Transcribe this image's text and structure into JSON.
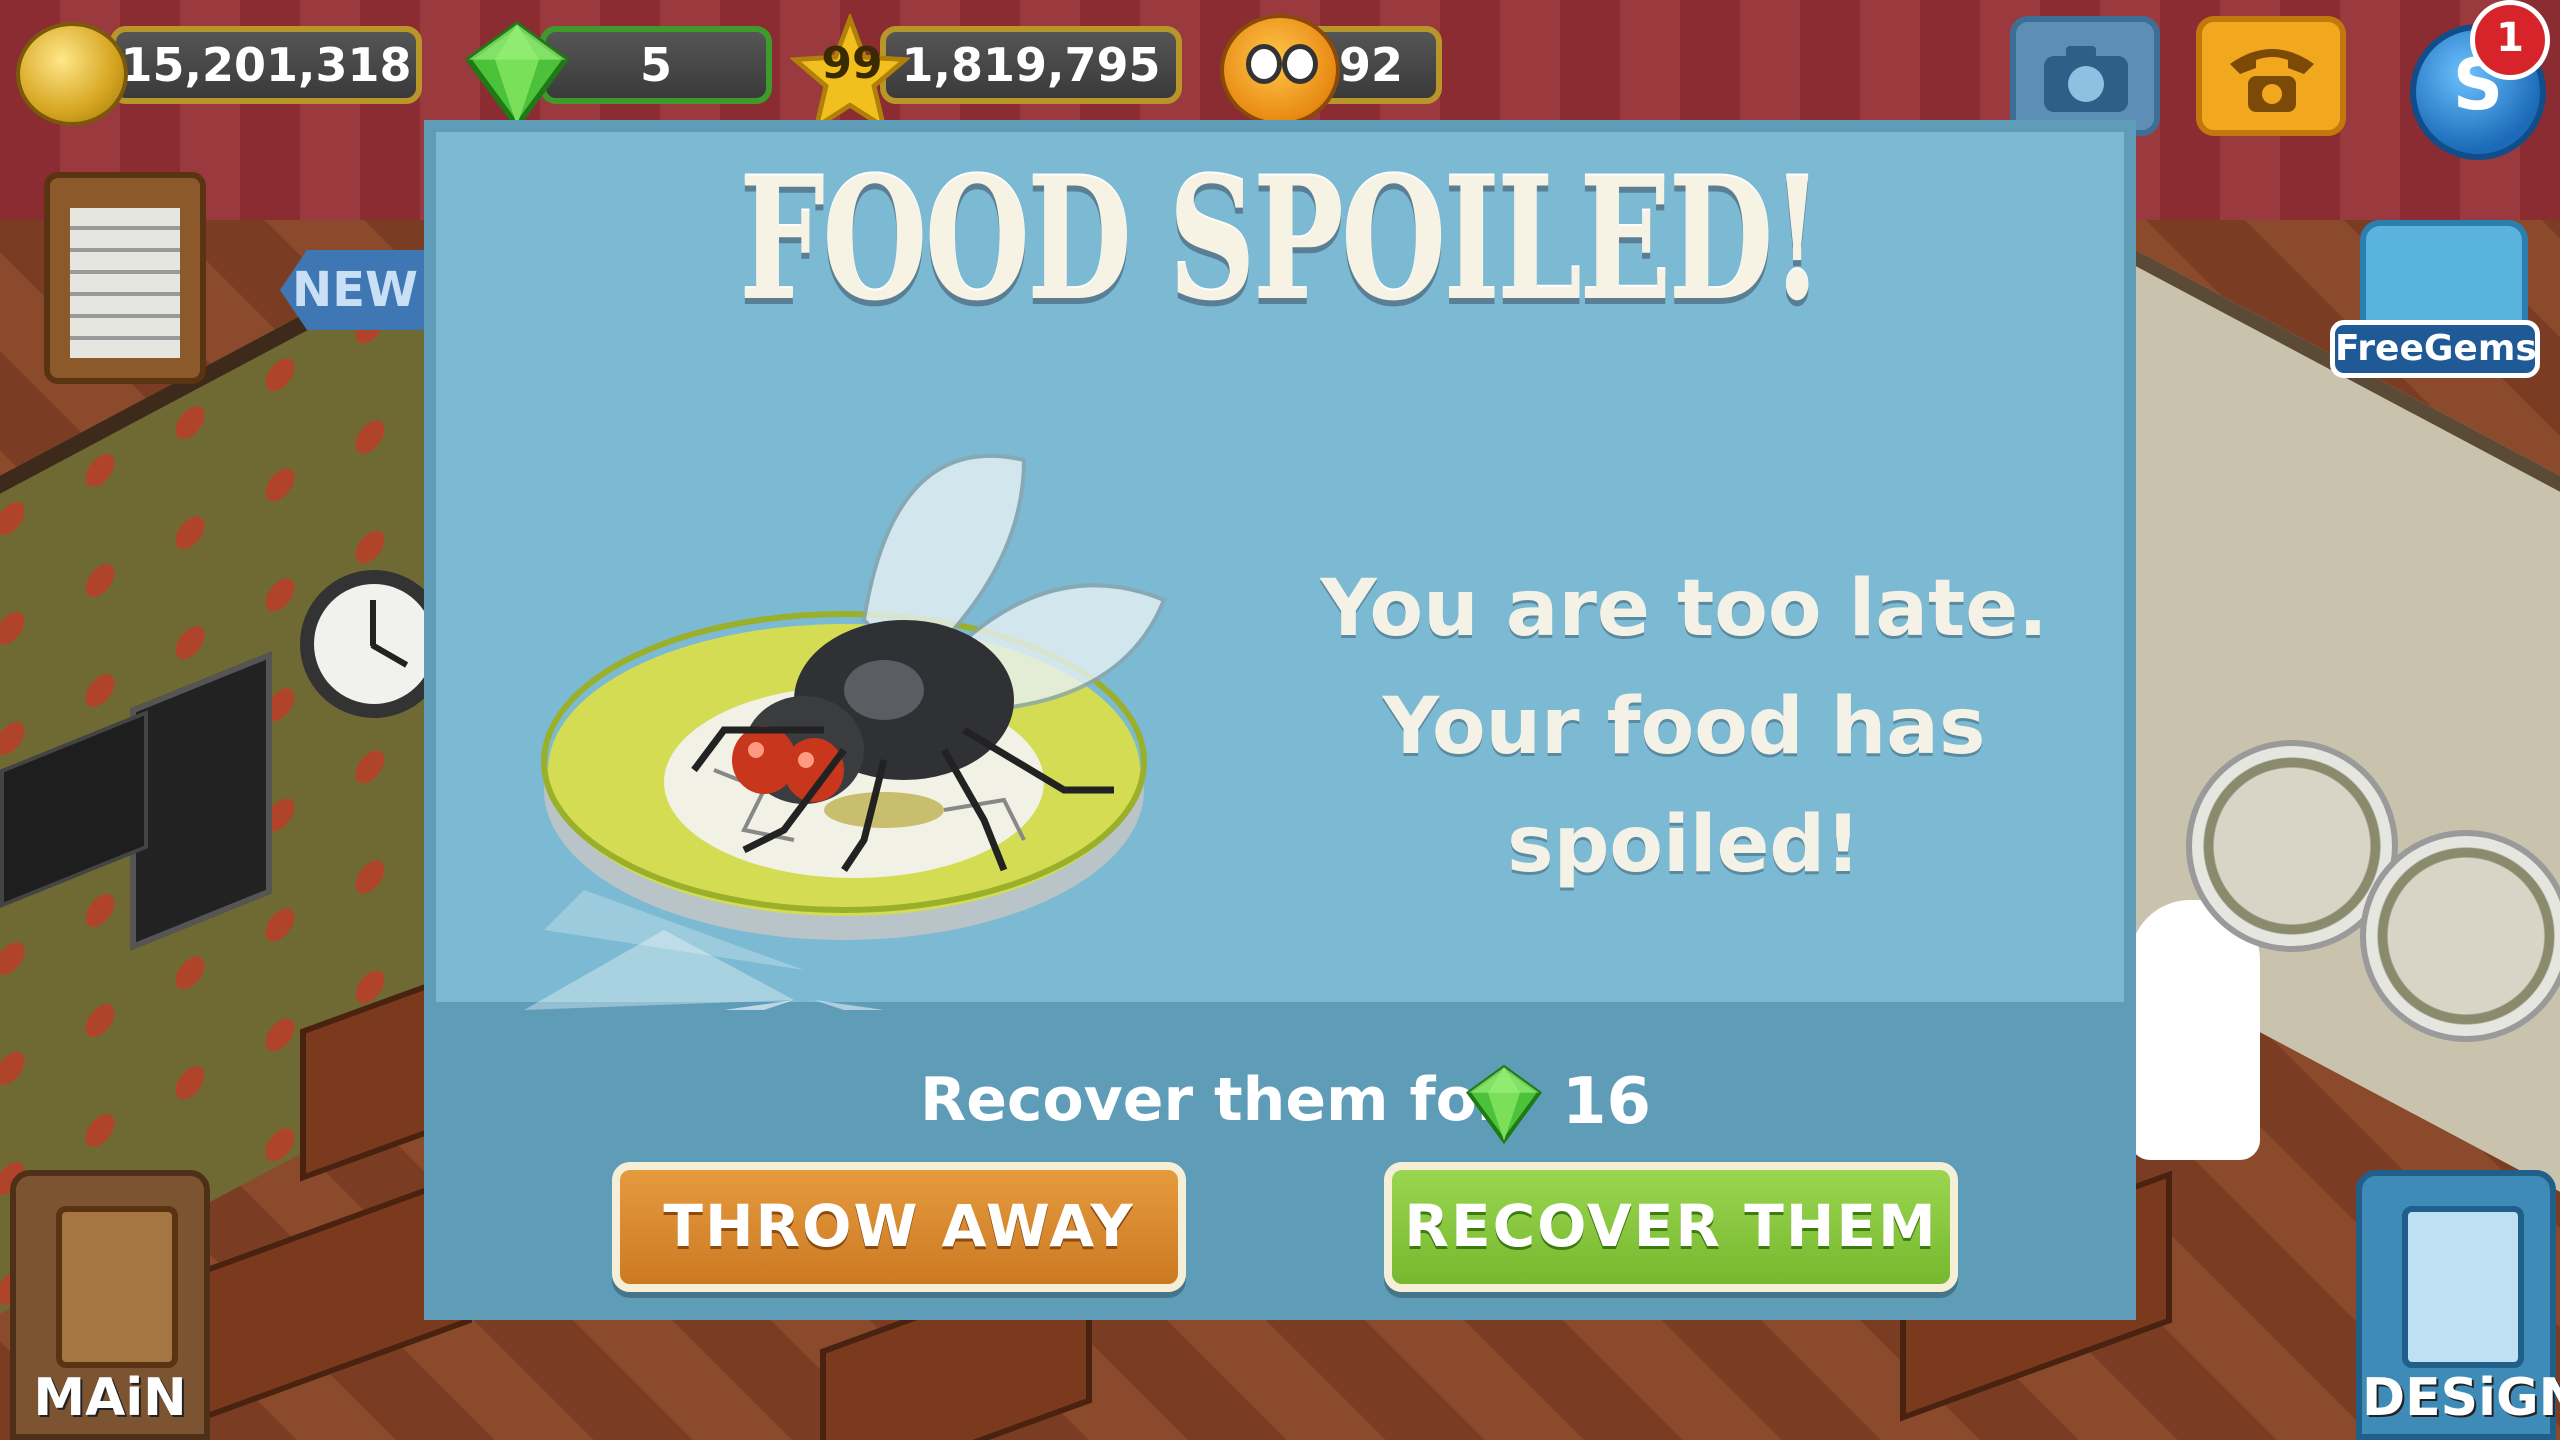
{
  "hud": {
    "coins": "15,201,318",
    "gems": "5",
    "level": "99",
    "experience": "1,819,795",
    "happiness": "92",
    "notification_count": "1",
    "free_gems_label": "FreeGems",
    "new_label": "NEW",
    "main_label": "MAiN",
    "design_label": "DESiGN"
  },
  "dialog": {
    "title": "FOOD SPOILED!",
    "message_line1": "You are too late.",
    "message_line2": "Your food has spoiled!",
    "recover_text": "Recover them for",
    "recover_cost": "16",
    "throw_away_label": "THROW AWAY",
    "recover_label": "RECOVER THEM"
  },
  "icons": {
    "coins": "coin-icon",
    "gems": "gem-icon",
    "level": "star-icon",
    "happiness": "smiley-icon",
    "camera": "camera-icon",
    "phone": "phone-icon",
    "gift": "gift-icon",
    "illustration": "fly-on-plate-icon"
  },
  "colors": {
    "dialog_bg": "#7bbad2",
    "dialog_frame": "#5e9cb8",
    "throw_button": "#d98a2e",
    "recover_button": "#86c63c",
    "gem_green": "#4cc23a"
  }
}
